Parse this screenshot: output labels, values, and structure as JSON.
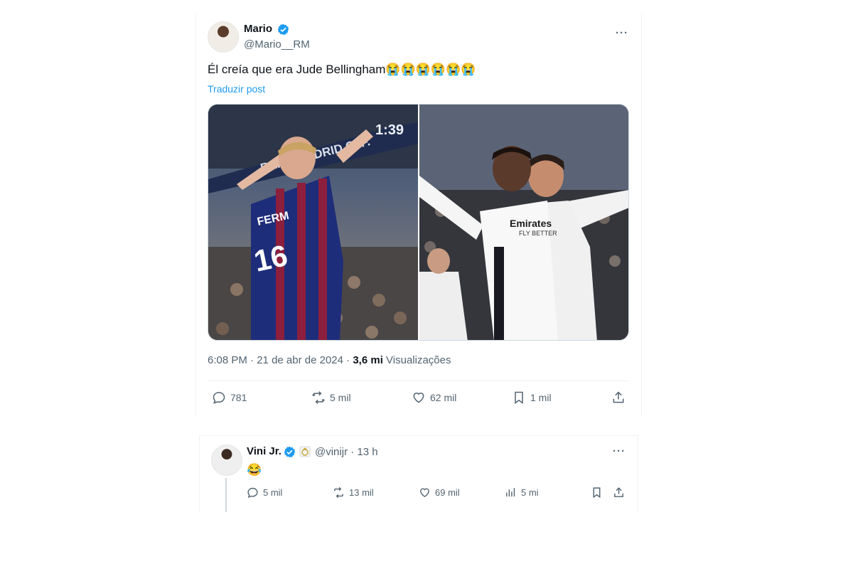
{
  "main_post": {
    "author_name": "Mario",
    "author_handle": "@Mario__RM",
    "text": "Él creía que era Jude Bellingham😭😭😭😭😭😭",
    "translate_label": "Traduzir post",
    "time": "6:08 PM",
    "date": "21 de abr de 2024",
    "views_count": "3,6 mi",
    "views_label": "Visualizações",
    "media": {
      "left_banner": "REAL MADRID C. F.",
      "left_clock": "1:39",
      "left_jersey_name": "FERM",
      "left_jersey_number": "16",
      "right_sponsor": "Emirates",
      "right_sponsor_sub": "FLY BETTER"
    },
    "actions": {
      "replies": "781",
      "reposts": "5 mil",
      "likes": "62 mil",
      "bookmarks": "1 mil"
    }
  },
  "reply": {
    "author_name": "Vini Jr.",
    "author_handle": "@vinijr",
    "separator": "·",
    "time": "13 h",
    "text": "😂",
    "actions": {
      "replies": "5 mil",
      "reposts": "13 mil",
      "likes": "69 mil",
      "views": "5 mi"
    }
  },
  "colors": {
    "accent": "#1d9bf0",
    "muted": "#536471",
    "border": "#eff3f4"
  }
}
